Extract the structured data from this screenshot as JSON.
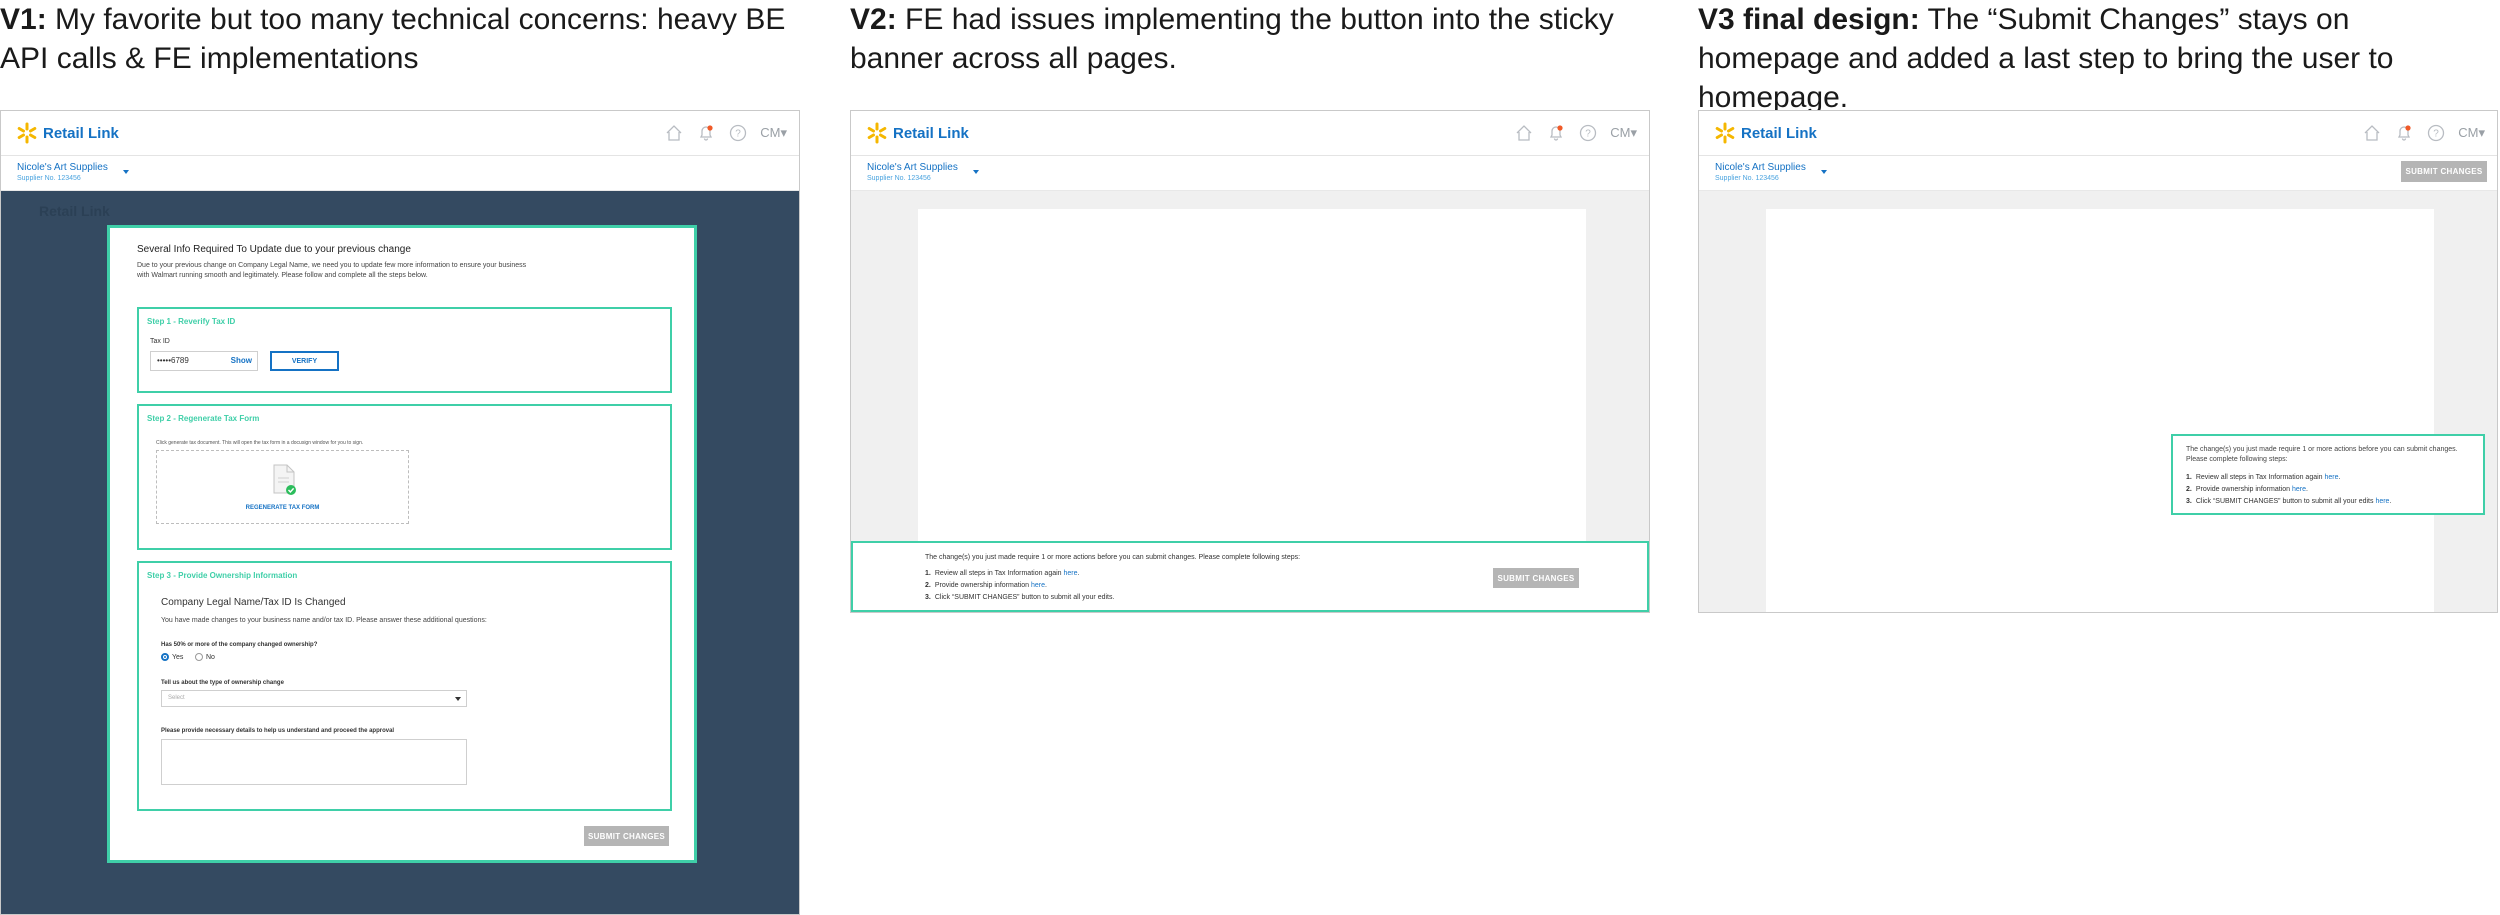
{
  "captions": [
    {
      "lead": "V1:",
      "text": " My favorite but too many technical concerns: heavy BE API calls & FE implementations"
    },
    {
      "lead": "V2:",
      "text": " FE had issues implementing the button into the sticky banner across all pages."
    },
    {
      "lead": "V3 final design:",
      "text": " The “Submit Changes” stays on homepage and added a last step to bring the user to homepage."
    }
  ],
  "app": {
    "logo_text": "Retail Link",
    "user_initials": "CM",
    "supplier_name": "Nicole's Art Supplies",
    "supplier_number": "Supplier No. 123456",
    "submit_label": "SUBMIT CHANGES"
  },
  "v1": {
    "modal_title": "Several Info Required To Update due to your previous change",
    "modal_desc_1": "Due to your previous change on Company Legal Name, we need you to update few more information to ensure your business",
    "modal_desc_2": "with Walmart running smooth and legitimately. Please follow and complete all the steps below.",
    "step1": {
      "title": "Step 1 - Reverify Tax ID",
      "field_label": "Tax ID",
      "tax_value": "•••••6789",
      "show_label": "Show",
      "verify_label": "VERIFY"
    },
    "step2": {
      "title": "Step 2 - Regenerate Tax Form",
      "hint": "Click generate tax document. This will open the tax form in a docusign window for you to sign.",
      "regen_label": "REGENERATE TAX FORM"
    },
    "step3": {
      "title": "Step 3 - Provide Ownership Information",
      "heading": "Company Legal Name/Tax ID Is Changed",
      "desc": "You have made changes to your business name and/or tax ID. Please answer these additional questions:",
      "q1": "Has 50% or more of the company changed ownership?",
      "yes": "Yes",
      "no": "No",
      "q2": "Tell us about the type of ownership change",
      "select_placeholder": "Select",
      "q3": "Please provide necessary details to help us understand and proceed the approval"
    }
  },
  "banner": {
    "intro": "The change(s) you just made require 1 or more actions before you can submit changes. Please complete following steps:",
    "intro_line1": "The change(s) you just made require 1 or more actions before you can submit changes.",
    "intro_line2": "Please complete following steps:",
    "step1_text": "Review all steps in Tax Information again ",
    "step2_text": "Provide ownership information ",
    "step3_v2": "Click “SUBMIT CHANGES” button to submit all your edits.",
    "step3_v3": "Click “SUBMIT CHANGES” button to submit all your edits ",
    "here": "here",
    "n1": "1.",
    "n2": "2.",
    "n3": "3."
  },
  "colors": {
    "accent_teal": "#3fcfa8",
    "brand_blue": "#1572c4",
    "overlay_navy": "#344a61",
    "disabled_gray": "#b5b5b5"
  }
}
